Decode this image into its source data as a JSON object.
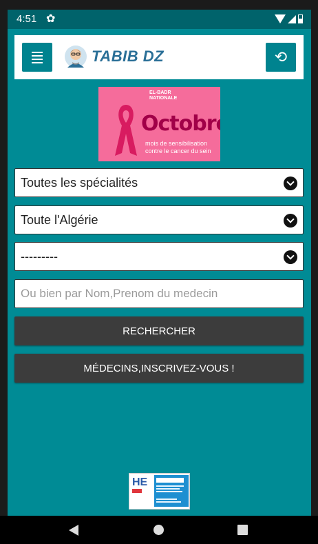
{
  "status_bar": {
    "time": "4:51",
    "settings_glyph": "✿"
  },
  "header": {
    "app_name": "TABIB DZ",
    "refresh_glyph": "⟲"
  },
  "banner": {
    "org": "EL-BADR\nNATIONALE",
    "title": "Octobre",
    "subtitle": "mois de sensibilisation\ncontre le cancer du sein",
    "background_color": "#f56c9b"
  },
  "filters": {
    "specialty": "Toutes les spécialités",
    "region": "Toute l'Algérie",
    "commune": "---------"
  },
  "search": {
    "placeholder": "Ou bien par Nom,Prenom du medecin",
    "value": ""
  },
  "buttons": {
    "search": "RECHERCHER",
    "register": "MÉDECINS,INSCRIVEZ-VOUS !"
  },
  "ad": {
    "logo_text": "HE"
  },
  "colors": {
    "app_background": "#008b95",
    "status_bar": "#00636b",
    "accent_button": "#00838f",
    "action_button": "#3c3c3c"
  },
  "icons": {
    "menu": "menu-icon",
    "refresh": "refresh-icon",
    "dropdown": "chevron-down-icon",
    "nav_back": "back-triangle-icon",
    "nav_home": "home-circle-icon",
    "nav_recents": "recents-square-icon"
  }
}
